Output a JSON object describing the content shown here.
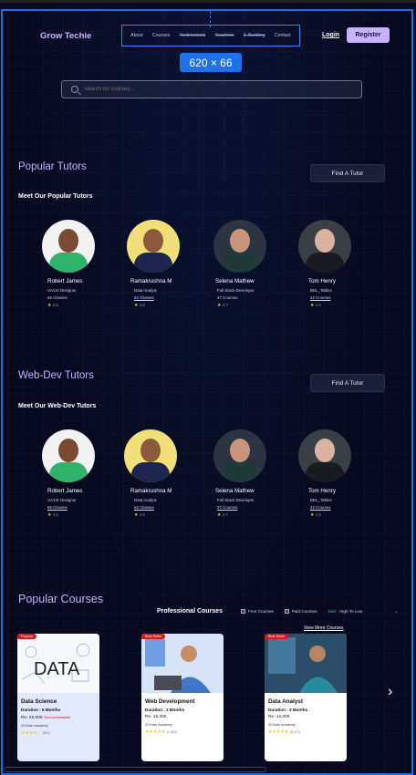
{
  "header": {
    "brand": "Grow Techie",
    "nav": [
      {
        "label": "About",
        "strike": false
      },
      {
        "label": "Courses",
        "strike": false
      },
      {
        "label": "Testimonials",
        "strike": true
      },
      {
        "label": "Teachers",
        "strike": true
      },
      {
        "label": "E-Building",
        "strike": true
      },
      {
        "label": "Contact",
        "strike": false
      }
    ],
    "login": "Login",
    "register": "Register",
    "dimension_badge": "620 × 66"
  },
  "search": {
    "placeholder": "Search for courses...",
    "value": ""
  },
  "popular_tutors": {
    "title": "Popular Tutors",
    "subtitle": "Meet Our Popular Tutors",
    "button": "Find A Tutor",
    "tutors": [
      {
        "name": "Robert James",
        "role": "VA/UX Designer",
        "classes": "56 Classes",
        "rating": "4.5"
      },
      {
        "name": "Ramakrushna M",
        "role": "Data Analyst",
        "classes": "62 Classes",
        "rating": "4.8"
      },
      {
        "name": "Selena Mathew",
        "role": "Full Stack Developer",
        "classes": "37 Courses",
        "rating": "4.7"
      },
      {
        "name": "Tom  Henry",
        "role": "BDL_Tables",
        "classes": "42 Courses",
        "rating": "4.9"
      }
    ]
  },
  "webdev_tutors": {
    "title": "Web-Dev Tutors",
    "subtitle": "Meet Our Web-Dev Tutors",
    "button": "Find A Tutor",
    "tutors": [
      {
        "name": "Robert James",
        "role": "VA/UX Designer",
        "classes": "56 Classes",
        "rating": "4.5"
      },
      {
        "name": "Ramakrushna M",
        "role": "Data Analyst",
        "classes": "62 Classes",
        "rating": "4.8"
      },
      {
        "name": "Selena Mathew",
        "role": "Full Stack Developer",
        "classes": "37 Courses",
        "rating": "4.7"
      },
      {
        "name": "Tom  Henry",
        "role": "BDL_Tables",
        "classes": "42 Courses",
        "rating": "4.9"
      }
    ]
  },
  "courses": {
    "title": "Popular Courses",
    "filter_title": "Professional Courses",
    "free_label": "Free Courses",
    "paid_label": "Paid Courses",
    "sort_label": "Sort:",
    "sort_value": "High To Low",
    "view_more": "View More Courses",
    "items": [
      {
        "tag": "Popular",
        "name": "Data Science",
        "duration": "Duration : 6 Months",
        "price": "Rs- 25,000",
        "price_note": "*Non-refundable",
        "academy": "Khan Academy",
        "stars": "★★★★☆",
        "count": "(891)",
        "image_text": "DATA"
      },
      {
        "tag": "Best Seller",
        "name": "Web Development",
        "duration": "Duration : 3 Months",
        "price": "Rs- 15,000",
        "price_note": "",
        "academy": "Khan Academy",
        "stars": "★★★★★",
        "count": "(1,082)",
        "image_text": ""
      },
      {
        "tag": "Best Seller",
        "name": "Data Analyst",
        "duration": "Duration : 3 Months",
        "price": "Rs- 12,000",
        "price_note": "",
        "academy": "Khan Academy",
        "stars": "★★★★★",
        "count": "(5,471)",
        "image_text": ""
      }
    ]
  },
  "colors": {
    "accent": "#c8b2ff",
    "title": "#c7b0ff",
    "frame": "#1e6fe0"
  }
}
